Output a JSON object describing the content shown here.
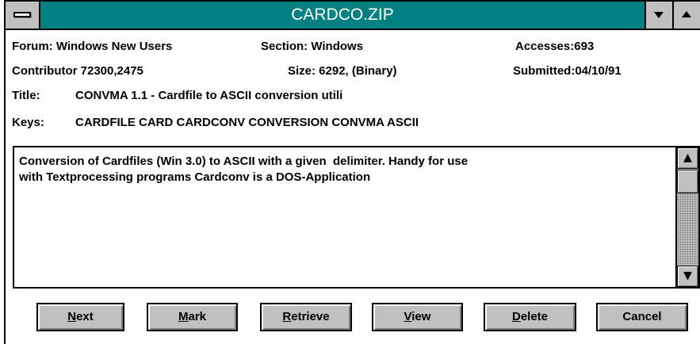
{
  "window": {
    "title": "CARDCO.ZIP"
  },
  "info": {
    "forum": "Forum: Windows New Users",
    "section": "Section: Windows",
    "accesses": "Accesses:693",
    "contributor": "Contributor 72300,2475",
    "size": "Size: 6292, (Binary)",
    "submitted": "Submitted:04/10/91",
    "title_label": "Title:",
    "title_value": "CONVMA 1.1 - Cardfile to ASCII conversion utili",
    "keys_label": "Keys:",
    "keys_value": "CARDFILE CARD CARDCONV CONVERSION CONVMA ASCII"
  },
  "description": {
    "text": "Conversion of Cardfiles (Win 3.0) to ASCII with a given  delimiter. Handy for use\nwith Textprocessing programs Cardconv is a DOS-Application"
  },
  "buttons": {
    "next_mnemonic": "N",
    "next_rest": "ext",
    "mark_mnemonic": "M",
    "mark_rest": "ark",
    "retrieve_mnemonic": "R",
    "retrieve_rest": "etrieve",
    "view_mnemonic": "V",
    "view_rest": "iew",
    "delete_mnemonic": "D",
    "delete_rest": "elete",
    "cancel": "Cancel"
  },
  "icons": {
    "scroll_up": "▲",
    "scroll_down": "▼"
  },
  "colors": {
    "titlebar": "#008080",
    "face": "#c0c0c0"
  }
}
